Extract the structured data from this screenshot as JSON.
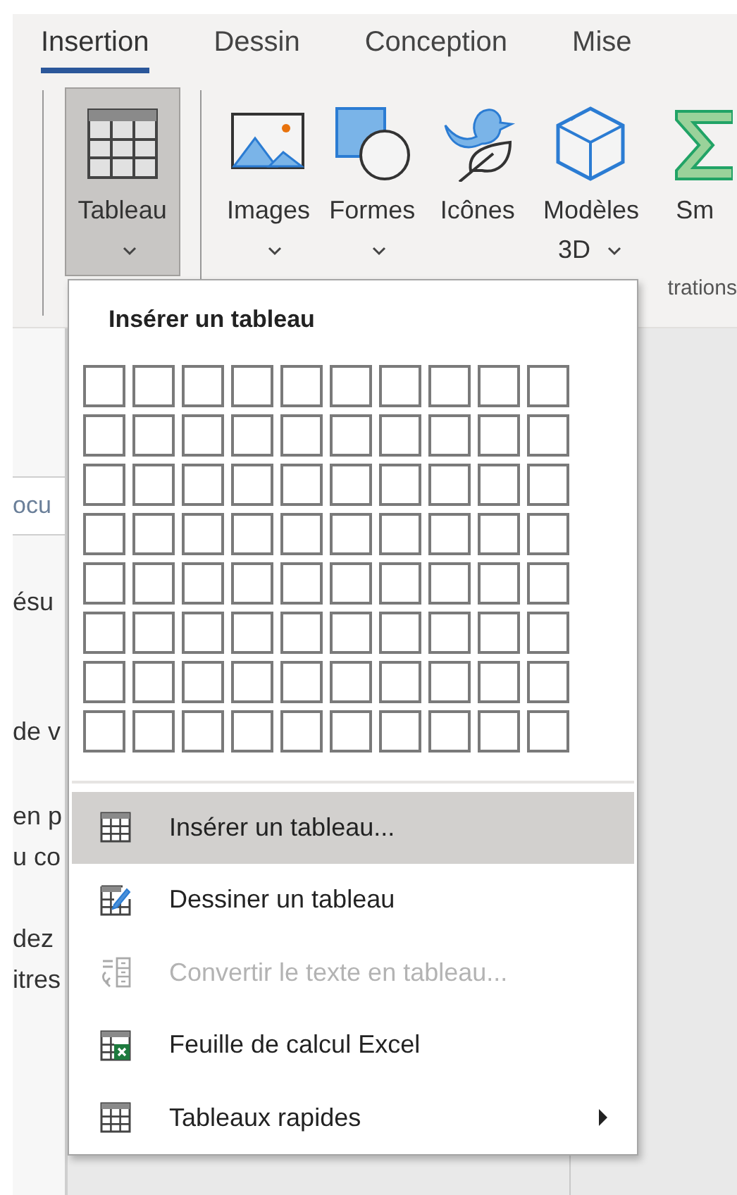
{
  "tabs": [
    {
      "label": "Insertion",
      "selected": true
    },
    {
      "label": "Dessin",
      "selected": false
    },
    {
      "label": "Conception",
      "selected": false
    },
    {
      "label": "Mise",
      "selected": false
    }
  ],
  "ribbon": {
    "buttons": [
      {
        "label": "Tableau",
        "kind": "table",
        "selected": true,
        "dropdown": true
      },
      {
        "label": "Images",
        "kind": "image",
        "selected": false,
        "dropdown": true
      },
      {
        "label": "Formes",
        "kind": "shapes",
        "selected": false,
        "dropdown": true
      },
      {
        "label": "Icônes",
        "kind": "icons",
        "selected": false,
        "dropdown": false
      },
      {
        "label": "Modèles 3D",
        "kind": "cube",
        "selected": false,
        "dropdown": true
      },
      {
        "label": "Sm",
        "kind": "smartart",
        "selected": false,
        "dropdown": false
      }
    ],
    "group_label": "trations"
  },
  "document_pane": {
    "search_value": "ocu",
    "lines": [
      "ésu",
      "de v",
      "en p",
      "u co",
      "dez",
      "itres"
    ]
  },
  "menu": {
    "title": "Insérer un tableau",
    "grid_rows": [
      [
        {
          "selected": false
        },
        {
          "selected": false
        },
        {
          "selected": false
        },
        {
          "selected": false
        },
        {
          "selected": false
        },
        {
          "selected": false
        },
        {
          "selected": false
        },
        {
          "selected": false
        },
        {
          "selected": false
        },
        {
          "selected": false
        }
      ],
      [
        {
          "selected": false
        },
        {
          "selected": false
        },
        {
          "selected": false
        },
        {
          "selected": false
        },
        {
          "selected": false
        },
        {
          "selected": false
        },
        {
          "selected": false
        },
        {
          "selected": false
        },
        {
          "selected": false
        },
        {
          "selected": false
        }
      ],
      [
        {
          "selected": false
        },
        {
          "selected": false
        },
        {
          "selected": false
        },
        {
          "selected": false
        },
        {
          "selected": false
        },
        {
          "selected": false
        },
        {
          "selected": false
        },
        {
          "selected": false
        },
        {
          "selected": false
        },
        {
          "selected": false
        }
      ],
      [
        {
          "selected": false
        },
        {
          "selected": false
        },
        {
          "selected": false
        },
        {
          "selected": false
        },
        {
          "selected": false
        },
        {
          "selected": false
        },
        {
          "selected": false
        },
        {
          "selected": false
        },
        {
          "selected": false
        },
        {
          "selected": false
        }
      ],
      [
        {
          "selected": false
        },
        {
          "selected": false
        },
        {
          "selected": false
        },
        {
          "selected": false
        },
        {
          "selected": false
        },
        {
          "selected": false
        },
        {
          "selected": false
        },
        {
          "selected": false
        },
        {
          "selected": false
        },
        {
          "selected": false
        }
      ],
      [
        {
          "selected": false
        },
        {
          "selected": false
        },
        {
          "selected": false
        },
        {
          "selected": false
        },
        {
          "selected": false
        },
        {
          "selected": false
        },
        {
          "selected": false
        },
        {
          "selected": false
        },
        {
          "selected": false
        },
        {
          "selected": false
        }
      ],
      [
        {
          "selected": false
        },
        {
          "selected": false
        },
        {
          "selected": false
        },
        {
          "selected": false
        },
        {
          "selected": false
        },
        {
          "selected": false
        },
        {
          "selected": false
        },
        {
          "selected": false
        },
        {
          "selected": false
        },
        {
          "selected": false
        }
      ],
      [
        {
          "selected": false
        },
        {
          "selected": false
        },
        {
          "selected": false
        },
        {
          "selected": false
        },
        {
          "selected": false
        },
        {
          "selected": false
        },
        {
          "selected": false
        },
        {
          "selected": false
        },
        {
          "selected": false
        },
        {
          "selected": false
        }
      ]
    ],
    "items": [
      {
        "label": "Insérer un tableau...",
        "kind": "table",
        "selected": true,
        "disabled": false,
        "submenu": false
      },
      {
        "label": "Dessiner un tableau",
        "kind": "draw",
        "selected": false,
        "disabled": false,
        "submenu": false
      },
      {
        "label": "Convertir le texte en tableau...",
        "kind": "convert",
        "selected": false,
        "disabled": true,
        "submenu": false
      },
      {
        "label": "Feuille de calcul Excel",
        "kind": "excel",
        "selected": false,
        "disabled": false,
        "submenu": false
      },
      {
        "label": "Tableaux rapides",
        "kind": "quick",
        "selected": false,
        "disabled": false,
        "submenu": true
      }
    ]
  }
}
